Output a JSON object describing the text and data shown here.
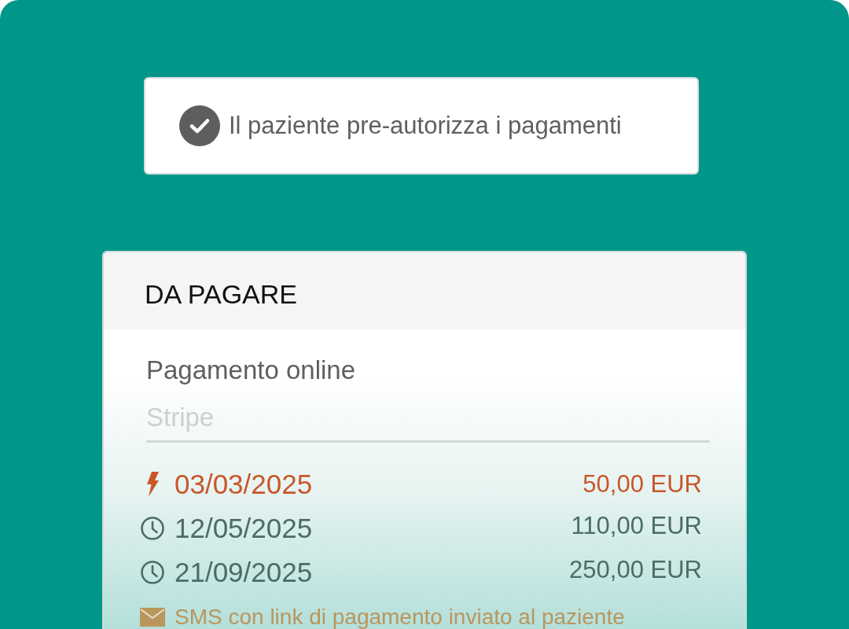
{
  "notice": {
    "text": "Il paziente pre-autorizza i pagamenti",
    "checked": true
  },
  "payment_card": {
    "title": "DA PAGARE",
    "method": {
      "label": "Pagamento online",
      "placeholder": "Stripe"
    },
    "installments": [
      {
        "kind": "due",
        "date": "03/03/2025",
        "amount": "50,00 EUR"
      },
      {
        "kind": "scheduled",
        "date": "12/05/2025",
        "amount": "110,00 EUR"
      },
      {
        "kind": "scheduled",
        "date": "21/09/2025",
        "amount": "250,00 EUR"
      }
    ],
    "footer_note": {
      "kind": "sms",
      "text": "SMS con link di pagamento inviato al paziente"
    }
  }
}
